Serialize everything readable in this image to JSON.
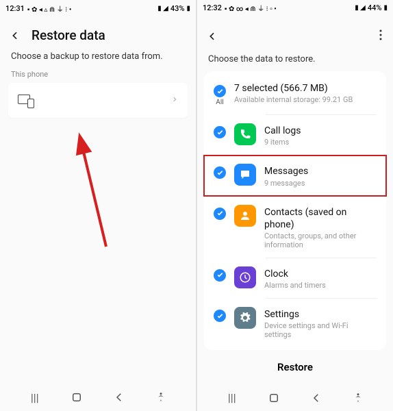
{
  "left": {
    "status": {
      "time": "12:31",
      "battery": "43%"
    },
    "title": "Restore data",
    "subtitle": "Choose a backup to restore data from.",
    "section_label": "This phone"
  },
  "right": {
    "status": {
      "time": "12:32",
      "battery": "44%"
    },
    "subtitle": "Choose the data to restore.",
    "summary": {
      "title": "7 selected (566.7 MB)",
      "sub": "Available internal storage: 99.21 GB",
      "check_label": "All"
    },
    "items": [
      {
        "title": "Call logs",
        "sub": "9 items",
        "color": "#00c853",
        "icon": "phone"
      },
      {
        "title": "Messages",
        "sub": "9 messages",
        "color": "#1e88ff",
        "icon": "message"
      },
      {
        "title": "Contacts (saved on phone)",
        "sub": "Contacts, groups, and other information",
        "color": "#ff9800",
        "icon": "contact"
      },
      {
        "title": "Clock",
        "sub": "Alarms and timers",
        "color": "#6a3fd6",
        "icon": "clock"
      },
      {
        "title": "Settings",
        "sub": "Device settings and Wi-Fi settings",
        "color": "#607d8b",
        "icon": "gear"
      }
    ],
    "restore_btn": "Restore"
  }
}
